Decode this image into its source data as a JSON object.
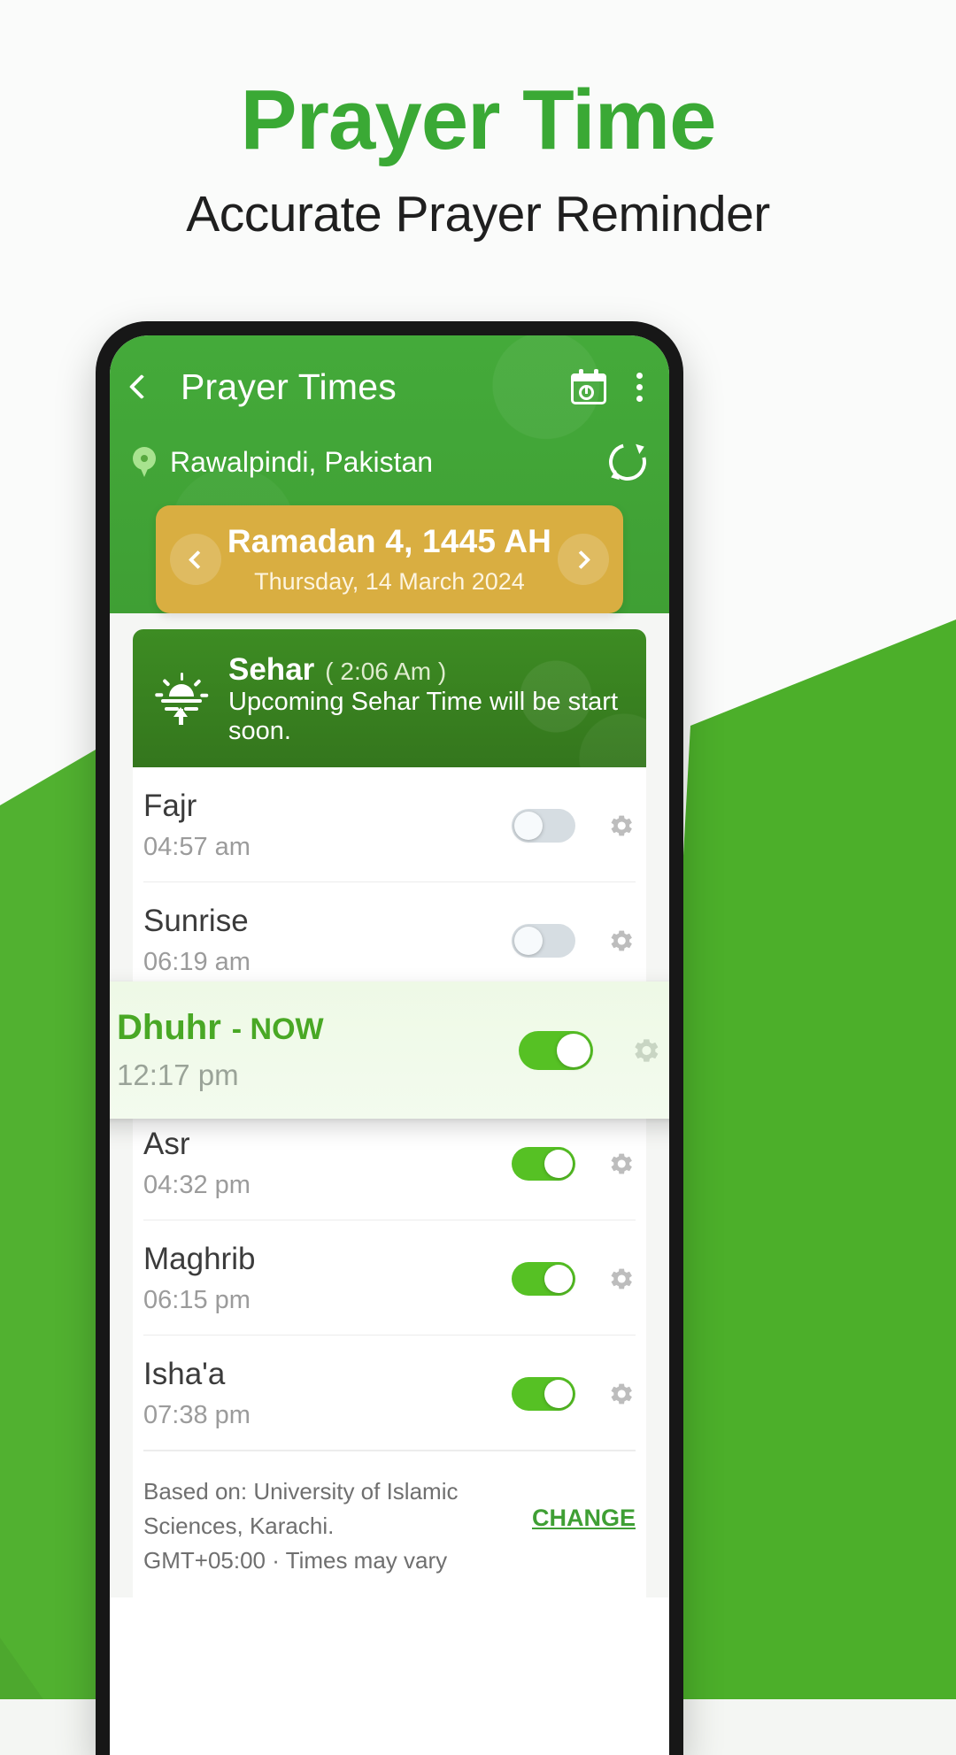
{
  "promo": {
    "title": "Prayer Time",
    "subtitle": "Accurate Prayer Reminder",
    "accent_color": "#3aa935"
  },
  "appbar": {
    "back_icon": "chevron-left-icon",
    "title": "Prayer Times",
    "calendar_icon": "calendar-clock-icon",
    "overflow_icon": "more-vertical-icon",
    "background_color": "#44aa3a"
  },
  "location": {
    "pin_icon": "location-pin-icon",
    "name": "Rawalpindi, Pakistan",
    "refresh_icon": "refresh-icon"
  },
  "date_card": {
    "prev_icon": "chevron-left-icon",
    "next_icon": "chevron-right-icon",
    "hijri": "Ramadan 4, 1445 AH",
    "gregorian": "Thursday, 14 March 2024",
    "background_color": "#d9ae41"
  },
  "sehar": {
    "icon": "sunrise-icon",
    "name": "Sehar",
    "time": "( 2:06 Am )",
    "message": "Upcoming Sehar Time will be start soon.",
    "background_color": "#3d8c23"
  },
  "prayers": [
    {
      "name": "Fajr",
      "time": "04:57 am",
      "alarm_on": false,
      "settings_icon": "gear-icon"
    },
    {
      "name": "Sunrise",
      "time": "06:19 am",
      "alarm_on": false,
      "settings_icon": "gear-icon"
    },
    {
      "name": "Asr",
      "time": "04:32 pm",
      "alarm_on": true,
      "settings_icon": "gear-icon"
    },
    {
      "name": "Maghrib",
      "time": "06:15 pm",
      "alarm_on": true,
      "settings_icon": "gear-icon"
    },
    {
      "name": "Isha'a",
      "time": "07:38 pm",
      "alarm_on": true,
      "settings_icon": "gear-icon"
    }
  ],
  "now_card": {
    "name": "Dhuhr",
    "badge": "- NOW",
    "time": "12:17 pm",
    "alarm_on": true,
    "settings_icon": "gear-icon",
    "accent_color": "#49a825"
  },
  "footer": {
    "line1": "Based on: University of Islamic Sciences, Karachi.",
    "line2": "GMT+05:00 · Times may vary",
    "change_label": "CHANGE"
  }
}
